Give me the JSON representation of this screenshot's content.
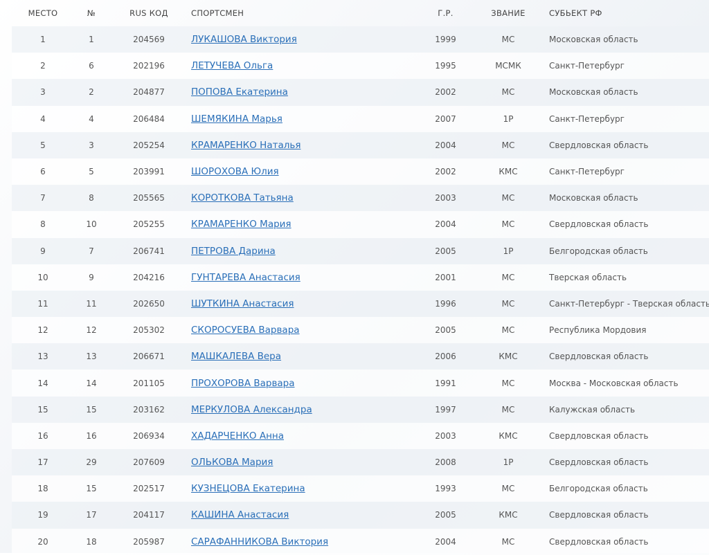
{
  "table": {
    "headers": {
      "place": "МЕСТО",
      "number": "№",
      "rus_code": "RUS КОД",
      "athlete": "СПОРТСМЕН",
      "birth_year": "Г.Р.",
      "rank": "ЗВАНИЕ",
      "region": "СУБЬЕКТ РФ"
    },
    "rows": [
      {
        "place": "1",
        "number": "1",
        "rus_code": "204569",
        "athlete": "ЛУКАШОВА Виктория",
        "birth_year": "1999",
        "rank": "МС",
        "region": "Московская область"
      },
      {
        "place": "2",
        "number": "6",
        "rus_code": "202196",
        "athlete": "ЛЕТУЧЕВА Ольга",
        "birth_year": "1995",
        "rank": "МСМК",
        "region": "Санкт-Петербург"
      },
      {
        "place": "3",
        "number": "2",
        "rus_code": "204877",
        "athlete": "ПОПОВА Екатерина",
        "birth_year": "2002",
        "rank": "МС",
        "region": "Московская область"
      },
      {
        "place": "4",
        "number": "4",
        "rus_code": "206484",
        "athlete": "ШЕМЯКИНА Марья",
        "birth_year": "2007",
        "rank": "1Р",
        "region": "Санкт-Петербург"
      },
      {
        "place": "5",
        "number": "3",
        "rus_code": "205254",
        "athlete": "КРАМАРЕНКО Наталья",
        "birth_year": "2004",
        "rank": "МС",
        "region": "Свердловская область"
      },
      {
        "place": "6",
        "number": "5",
        "rus_code": "203991",
        "athlete": "ШОРОХОВА Юлия",
        "birth_year": "2002",
        "rank": "КМС",
        "region": "Санкт-Петербург"
      },
      {
        "place": "7",
        "number": "8",
        "rus_code": "205565",
        "athlete": "КОРОТКОВА Татьяна",
        "birth_year": "2003",
        "rank": "МС",
        "region": "Московская область"
      },
      {
        "place": "8",
        "number": "10",
        "rus_code": "205255",
        "athlete": "КРАМАРЕНКО Мария",
        "birth_year": "2004",
        "rank": "МС",
        "region": "Свердловская область"
      },
      {
        "place": "9",
        "number": "7",
        "rus_code": "206741",
        "athlete": "ПЕТРОВА Дарина",
        "birth_year": "2005",
        "rank": "1Р",
        "region": "Белгородская область"
      },
      {
        "place": "10",
        "number": "9",
        "rus_code": "204216",
        "athlete": "ГУНТАРЕВА Анастасия",
        "birth_year": "2001",
        "rank": "МС",
        "region": "Тверская область"
      },
      {
        "place": "11",
        "number": "11",
        "rus_code": "202650",
        "athlete": "ШУТКИНА Анастасия",
        "birth_year": "1996",
        "rank": "МС",
        "region": "Санкт-Петербург - Тверская область"
      },
      {
        "place": "12",
        "number": "12",
        "rus_code": "205302",
        "athlete": "СКОРОСУЕВА Варвара",
        "birth_year": "2005",
        "rank": "МС",
        "region": "Республика Мордовия"
      },
      {
        "place": "13",
        "number": "13",
        "rus_code": "206671",
        "athlete": "МАШКАЛЕВА Вера",
        "birth_year": "2006",
        "rank": "КМС",
        "region": "Свердловская область"
      },
      {
        "place": "14",
        "number": "14",
        "rus_code": "201105",
        "athlete": "ПРОХОРОВА Варвара",
        "birth_year": "1991",
        "rank": "МС",
        "region": "Москва - Московская область"
      },
      {
        "place": "15",
        "number": "15",
        "rus_code": "203162",
        "athlete": "МЕРКУЛОВА Александра",
        "birth_year": "1997",
        "rank": "МС",
        "region": "Калужская область"
      },
      {
        "place": "16",
        "number": "16",
        "rus_code": "206934",
        "athlete": "ХАДАРЧЕНКО Анна",
        "birth_year": "2003",
        "rank": "КМС",
        "region": "Свердловская область"
      },
      {
        "place": "17",
        "number": "29",
        "rus_code": "207609",
        "athlete": "ОЛЬКОВА Мария",
        "birth_year": "2008",
        "rank": "1Р",
        "region": "Свердловская область"
      },
      {
        "place": "18",
        "number": "15",
        "rus_code": "202517",
        "athlete": "КУЗНЕЦОВА Екатерина",
        "birth_year": "1993",
        "rank": "МС",
        "region": "Белгородская область"
      },
      {
        "place": "19",
        "number": "17",
        "rus_code": "204117",
        "athlete": "КАШИНА Анастасия",
        "birth_year": "2005",
        "rank": "КМС",
        "region": "Свердловская область"
      },
      {
        "place": "20",
        "number": "18",
        "rus_code": "205987",
        "athlete": "САРАФАННИКОВА Виктория",
        "birth_year": "2004",
        "rank": "МС",
        "region": "Свердловская область"
      }
    ]
  }
}
